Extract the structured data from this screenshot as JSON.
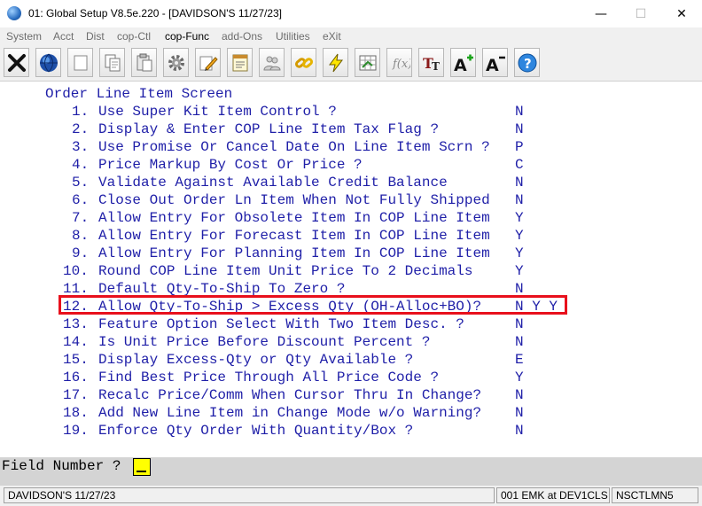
{
  "window": {
    "title": "01: Global Setup V8.5e.220 - [DAVIDSON'S 11/27/23]",
    "minimize": "—",
    "maximize": "☐",
    "close": "✕"
  },
  "menu": [
    {
      "label": "System",
      "enabled": false
    },
    {
      "label": "Acct",
      "enabled": false
    },
    {
      "label": "Dist",
      "enabled": false
    },
    {
      "label": "cop-Ctl",
      "enabled": false
    },
    {
      "label": "cop-Func",
      "enabled": true
    },
    {
      "label": "add-Ons",
      "enabled": false
    },
    {
      "label": "Utilities",
      "enabled": false
    },
    {
      "label": "eXit",
      "enabled": false
    }
  ],
  "toolbar": {
    "icons": [
      "exit-x-icon",
      "globe-icon",
      "blank-page-icon",
      "copy-icon",
      "paste-icon",
      "settings-gear-icon",
      "edit-pencil-icon",
      "notepad-icon",
      "people-icon",
      "chain-link-icon",
      "lightning-icon",
      "spreadsheet-icon",
      "function-icon",
      "text-font-icon",
      "font-increase-icon",
      "font-decrease-icon",
      "help-icon"
    ]
  },
  "screen": {
    "heading": "Order Line Item Screen",
    "items": [
      {
        "num": "1.",
        "label": "Use Super Kit Item Control ?",
        "value": "N"
      },
      {
        "num": "2.",
        "label": "Display & Enter COP Line Item Tax Flag ?",
        "value": "N"
      },
      {
        "num": "3.",
        "label": "Use Promise Or Cancel Date On Line Item Scrn ?",
        "value": "P"
      },
      {
        "num": "4.",
        "label": "Price Markup By Cost Or Price ?",
        "value": "C"
      },
      {
        "num": "5.",
        "label": "Validate Against Available Credit Balance",
        "value": "N"
      },
      {
        "num": "6.",
        "label": "Close Out Order Ln Item When Not Fully Shipped",
        "value": "N"
      },
      {
        "num": "7.",
        "label": "Allow Entry For Obsolete Item In COP Line Item",
        "value": "Y"
      },
      {
        "num": "8.",
        "label": "Allow Entry For Forecast Item In COP Line Item",
        "value": "Y"
      },
      {
        "num": "9.",
        "label": "Allow Entry For Planning Item In COP Line Item",
        "value": "Y"
      },
      {
        "num": "10.",
        "label": "Round COP Line Item Unit Price To 2 Decimals",
        "value": "Y"
      },
      {
        "num": "11.",
        "label": "Default Qty-To-Ship To Zero ?",
        "value": "N"
      },
      {
        "num": "12.",
        "label": "Allow Qty-To-Ship > Excess Qty (OH-Alloc+BO)?",
        "value": "N Y Y"
      },
      {
        "num": "13.",
        "label": "Feature Option Select With Two Item Desc. ?",
        "value": "N"
      },
      {
        "num": "14.",
        "label": "Is Unit Price Before Discount Percent ?",
        "value": "N"
      },
      {
        "num": "15.",
        "label": "Display Excess-Qty or Qty Available ?",
        "value": "E"
      },
      {
        "num": "16.",
        "label": "Find Best Price Through All Price Code ?",
        "value": "Y"
      },
      {
        "num": "17.",
        "label": "Recalc Price/Comm When Cursor Thru In Change?",
        "value": "N"
      },
      {
        "num": "18.",
        "label": "Add New Line Item in Change Mode w/o Warning?",
        "value": "N"
      },
      {
        "num": "19.",
        "label": "Enforce Qty Order With Quantity/Box ?",
        "value": "N"
      }
    ]
  },
  "field": {
    "label": "Field Number ?",
    "value": ""
  },
  "status": {
    "company": "DAVIDSON'S 11/27/23",
    "user": "001 EMK at DEV1CLS",
    "program": "NSCTLMN5"
  },
  "colors": {
    "terminal_text": "#1f1fa8",
    "highlight_box": "#e8101c",
    "field_input_bg": "#ffff00"
  }
}
